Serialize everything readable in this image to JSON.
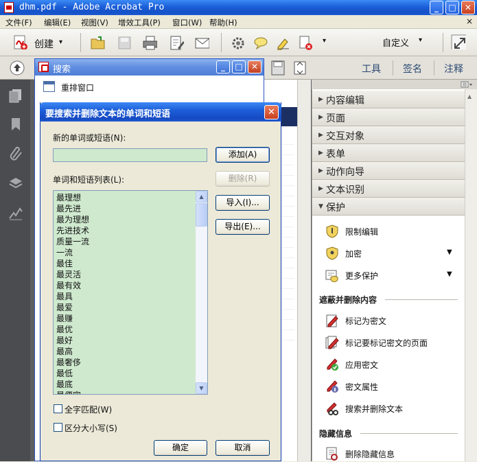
{
  "window": {
    "title": "dhm.pdf - Adobe Acrobat Pro",
    "controls": {
      "minimize": "_",
      "maximize": "□",
      "close": "✕"
    }
  },
  "menubar": {
    "items": [
      "文件(F)",
      "编辑(E)",
      "视图(V)",
      "增效工具(P)",
      "窗口(W)",
      "帮助(H)"
    ],
    "close": "×"
  },
  "toolbar": {
    "create_label": "创建",
    "create_arrow": "▾",
    "more_arrow": "▾",
    "custom_label": "自定义",
    "custom_arrow": "▾"
  },
  "navbar": {
    "tabs": [
      "工具",
      "签名",
      "注释"
    ]
  },
  "search_window": {
    "title": "搜索",
    "arrange_label": "重排窗口"
  },
  "dialog": {
    "title": "要搜索并删除文本的单词和短语",
    "close": "✕",
    "new_word_label": "新的单词或短语(N):",
    "new_word_value": "",
    "add_button": "添加(A)",
    "list_label": "单词和短语列表(L):",
    "delete_button": "删除(R)",
    "import_button": "导入(I)...",
    "export_button": "导出(E)...",
    "words": [
      "最理想",
      "最先进",
      "最为理想",
      "先进技术",
      "质量一流",
      "一流",
      "最佳",
      "最灵活",
      "最有效",
      "最具",
      "最爱",
      "最赚",
      "最优",
      "最好",
      "最高",
      "最奢侈",
      "最低",
      "最底",
      "最便宜"
    ],
    "whole_word_label": "全字匹配(W)",
    "case_sensitive_label": "区分大小写(S)",
    "ok_button": "确定",
    "cancel_button": "取消",
    "scroll_up": "▲",
    "scroll_down": "▼"
  },
  "tools_pane": {
    "collapsed_sections": [
      "内容编辑",
      "页面",
      "交互对象",
      "表单",
      "动作向导",
      "文本识别"
    ],
    "protect_header": "保护",
    "protect_items": [
      {
        "label": "限制编辑",
        "icon": "shield-icon"
      },
      {
        "label": "加密",
        "icon": "shield-key-icon"
      },
      {
        "label": "更多保护",
        "icon": "certificate-icon"
      }
    ],
    "redact_section": "遮蔽并删除内容",
    "redact_items": [
      {
        "label": "标记为密文",
        "icon": "redact-marker-icon"
      },
      {
        "label": "标记要标记密文的页面",
        "icon": "redact-pages-icon"
      },
      {
        "label": "应用密文",
        "icon": "apply-redaction-icon"
      },
      {
        "label": "密文属性",
        "icon": "redaction-properties-icon"
      },
      {
        "label": "搜索并删除文本",
        "icon": "search-remove-icon"
      }
    ],
    "hidden_section": "隐藏信息",
    "hidden_items": [
      {
        "label": "删除隐藏信息",
        "icon": "remove-hidden-info-icon"
      }
    ]
  },
  "colors": {
    "xp_blue": "#1d5fd9",
    "list_bg": "#cfe9cf",
    "left_panel": "#4b4c4f"
  }
}
